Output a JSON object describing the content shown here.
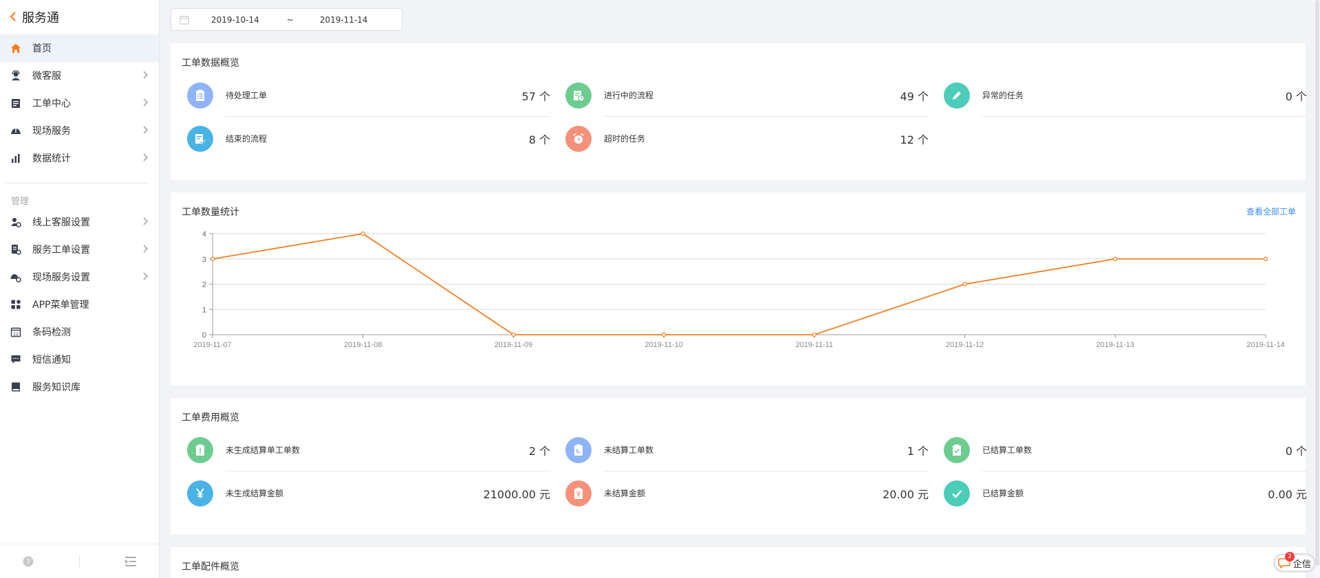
{
  "app": {
    "title": "服务通",
    "back_icon": "chevron-left-icon"
  },
  "sidebar": {
    "items": [
      {
        "label": "首页",
        "icon": "home-icon",
        "active": true,
        "chevron": false
      },
      {
        "label": "微客服",
        "icon": "headset-agent-icon",
        "chevron": true
      },
      {
        "label": "工单中心",
        "icon": "ticket-list-icon",
        "chevron": true
      },
      {
        "label": "现场服务",
        "icon": "helmet-icon",
        "chevron": true
      },
      {
        "label": "数据统计",
        "icon": "bar-chart-icon",
        "chevron": true
      }
    ],
    "section_label": "管理",
    "manage_items": [
      {
        "label": "线上客服设置",
        "icon": "agent-settings-icon",
        "chevron": true
      },
      {
        "label": "服务工单设置",
        "icon": "ticket-settings-icon",
        "chevron": true
      },
      {
        "label": "现场服务设置",
        "icon": "field-settings-icon",
        "chevron": true
      },
      {
        "label": "APP菜单管理",
        "icon": "grid-apps-icon",
        "chevron": false
      },
      {
        "label": "条码检测",
        "icon": "barcode-calendar-icon",
        "chevron": false
      },
      {
        "label": "短信通知",
        "icon": "sms-icon",
        "chevron": false
      },
      {
        "label": "服务知识库",
        "icon": "book-icon",
        "chevron": false
      }
    ],
    "footer": {
      "help_icon": "help-circle-icon",
      "collapse_icon": "collapse-menu-icon"
    }
  },
  "date_range": {
    "start": "2019-10-14",
    "separator": "~",
    "end": "2019-11-14",
    "icon": "calendar-icon"
  },
  "ticket_overview": {
    "title": "工单数据概览",
    "stats": [
      {
        "label": "待处理工单",
        "value": "57 个",
        "color": "#8fb4f5",
        "icon": "clipboard-list-icon"
      },
      {
        "label": "进行中的流程",
        "value": "49 个",
        "color": "#6dcc8f",
        "icon": "doc-clock-icon"
      },
      {
        "label": "异常的任务",
        "value": "0 个",
        "color": "#4ccdb9",
        "icon": "pencil-icon"
      },
      {
        "label": "结束的流程",
        "value": "8 个",
        "color": "#4ab3e6",
        "icon": "doc-check-icon"
      },
      {
        "label": "超时的任务",
        "value": "12 个",
        "color": "#f5917a",
        "icon": "alarm-clock-icon"
      }
    ]
  },
  "ticket_stats": {
    "title": "工单数量统计",
    "link": "查看全部工单"
  },
  "chart_data": {
    "type": "line",
    "categories": [
      "2019-11-07",
      "2019-11-08",
      "2019-11-09",
      "2019-11-10",
      "2019-11-11",
      "2019-11-12",
      "2019-11-13",
      "2019-11-14"
    ],
    "values": [
      3,
      4,
      0,
      0,
      0,
      2,
      3,
      3
    ],
    "ylim": [
      0,
      4
    ],
    "yticks": [
      "0",
      "1",
      "2",
      "3",
      "4"
    ],
    "grid": true,
    "color": "#f57f22",
    "title": "",
    "xlabel": "",
    "ylabel": ""
  },
  "fee_overview": {
    "title": "工单费用概览",
    "stats": [
      {
        "label": "未生成结算单工单数",
        "value": "2 个",
        "color": "#6dcc8f",
        "icon": "clipboard-alert-icon"
      },
      {
        "label": "未结算工单数",
        "value": "1 个",
        "color": "#8fb4f5",
        "icon": "clipboard-clock-icon"
      },
      {
        "label": "已结算工单数",
        "value": "0 个",
        "color": "#6dcc8f",
        "icon": "clipboard-check-icon"
      },
      {
        "label": "未生成结算金额",
        "value": "21000.00 元",
        "color": "#4ab3e6",
        "icon": "yen-icon"
      },
      {
        "label": "未结算金额",
        "value": "20.00 元",
        "color": "#f5917a",
        "icon": "clipboard-yen-icon"
      },
      {
        "label": "已结算金额",
        "value": "0.00 元",
        "color": "#4ccdb9",
        "icon": "check-icon"
      }
    ]
  },
  "parts_overview": {
    "title": "工单配件概览"
  },
  "chat_widget": {
    "label": "企信",
    "badge": "2",
    "icon": "chat-bubble-icon"
  }
}
